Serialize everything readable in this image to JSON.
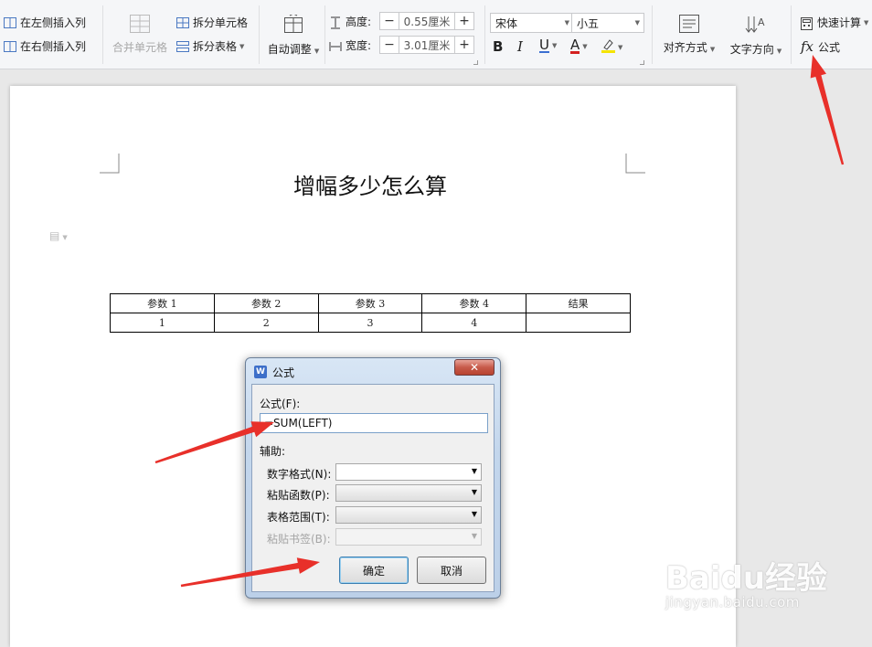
{
  "ribbon": {
    "insert_left_col": "在左侧插入列",
    "insert_right_col": "在右侧插入列",
    "merge_cells": "合并单元格",
    "split_cells": "拆分单元格",
    "split_table": "拆分表格",
    "auto_adjust": "自动调整",
    "height_label": "高度:",
    "height_value": "0.55厘米",
    "width_label": "宽度:",
    "width_value": "3.01厘米",
    "font_name": "宋体",
    "font_size": "小五",
    "bold": "B",
    "italic": "I",
    "underline": "U",
    "font_color": "A",
    "align": "对齐方式",
    "text_direction": "文字方向",
    "quick_calc": "快速计算",
    "formula_fx": "fx",
    "formula": "公式"
  },
  "document": {
    "title": "增幅多少怎么算",
    "table": {
      "headers": [
        "参数 1",
        "参数 2",
        "参数 3",
        "参数 4",
        "结果"
      ],
      "rows": [
        [
          "1",
          "2",
          "3",
          "4",
          ""
        ]
      ]
    }
  },
  "dialog": {
    "title": "公式",
    "app_icon": "W",
    "close": "✕",
    "formula_label": "公式(F):",
    "formula_value": "=SUM(LEFT)",
    "aux_label": "辅助:",
    "number_format_label": "数字格式(N):",
    "paste_function_label": "粘贴函数(P):",
    "table_range_label": "表格范围(T):",
    "paste_bookmark_label": "粘贴书签(B):",
    "ok": "确定",
    "cancel": "取消"
  },
  "watermark": {
    "logo": "Baidu经验",
    "url": "jingyan.baidu.com"
  },
  "colors": {
    "annotation_arrow": "#e8302a",
    "font_color_underline": "#d42020",
    "highlight": "#f5e400",
    "underline_color": "#3b6fd1"
  }
}
